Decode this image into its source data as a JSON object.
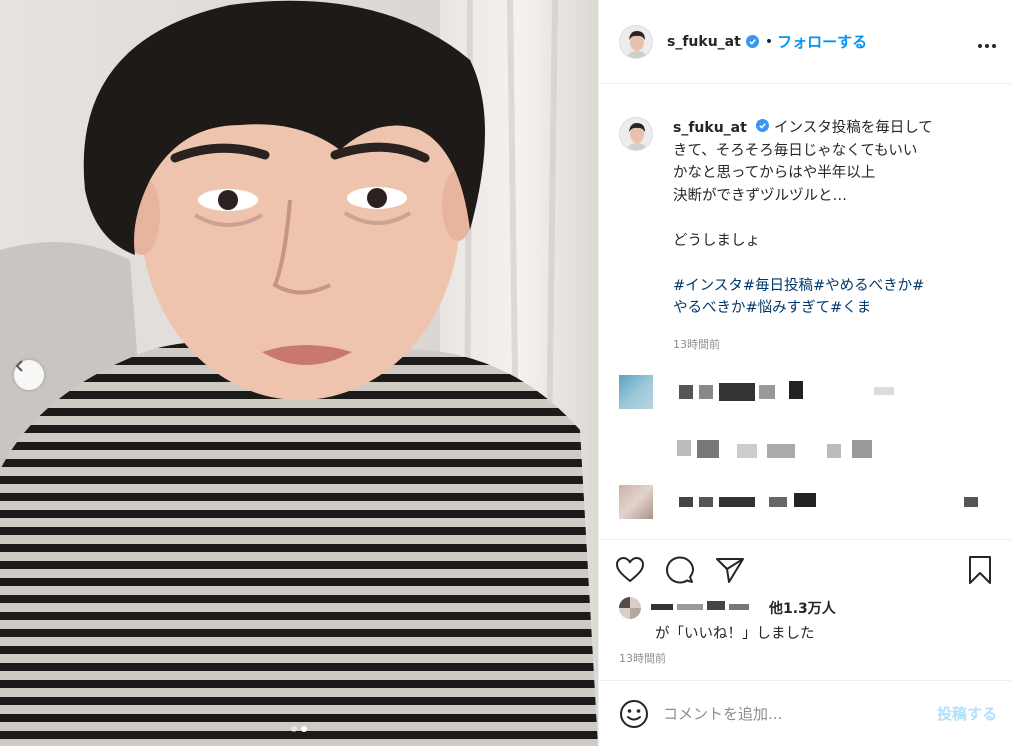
{
  "post": {
    "username": "s_fuku_at",
    "verified": true,
    "follow_label": "フォローする",
    "separator": "•",
    "more_label": "•••",
    "caption_lines": [
      "インスタ投稿を毎日して",
      "きて、そろそろ毎日じゃなくてもいい",
      "かなと思ってからはや半年以上",
      "決断ができずヅルヅルと…",
      "",
      "どうしましょ"
    ],
    "hashtags_line1": "#インスタ#毎日投稿#やめるべきか#",
    "hashtags_line2": "やるべきか#悩みすぎて#くま",
    "caption_time": "13時間前",
    "likes_others": "他1.3万人",
    "liked_text": "が「いいね！」しました",
    "post_time": "13時間前",
    "comment_placeholder": "コメントを追加...",
    "post_button": "投稿する"
  },
  "icons": {
    "prev": "chevron-left-icon",
    "like": "heart-icon",
    "comment": "comment-icon",
    "share": "paper-plane-icon",
    "save": "bookmark-icon",
    "emoji": "smiley-icon",
    "verified": "verified-badge-icon"
  },
  "colors": {
    "accent": "#0095f6",
    "hashtag": "#00376b",
    "muted": "#8e8e8e",
    "post_disabled": "#b2dffc"
  }
}
